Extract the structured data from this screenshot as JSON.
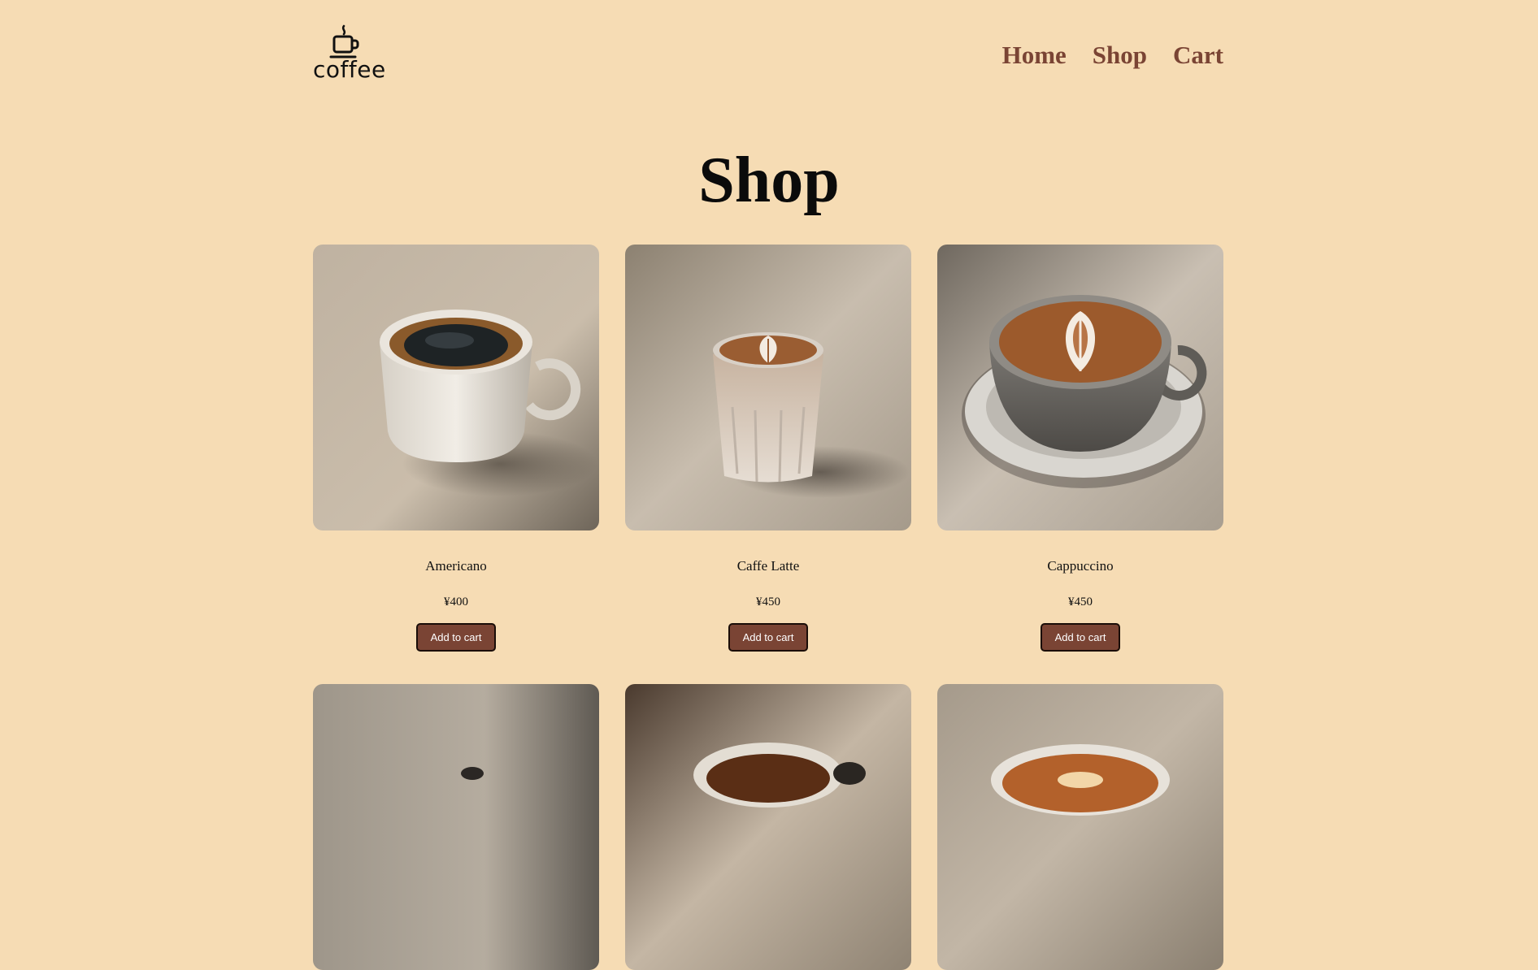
{
  "brand": {
    "logo_icon": "coffee-cup-icon",
    "name": "coffee"
  },
  "nav": {
    "items": [
      {
        "label": "Home"
      },
      {
        "label": "Shop"
      },
      {
        "label": "Cart"
      }
    ]
  },
  "page": {
    "title": "Shop"
  },
  "products": [
    {
      "name": "Americano",
      "price": "¥400",
      "button": "Add to cart"
    },
    {
      "name": "Caffe Latte",
      "price": "¥450",
      "button": "Add to cart"
    },
    {
      "name": "Cappuccino",
      "price": "¥450",
      "button": "Add to cart"
    }
  ],
  "colors": {
    "background": "#f6dcb4",
    "accent": "#7a4434",
    "button_text": "#ffffff"
  }
}
